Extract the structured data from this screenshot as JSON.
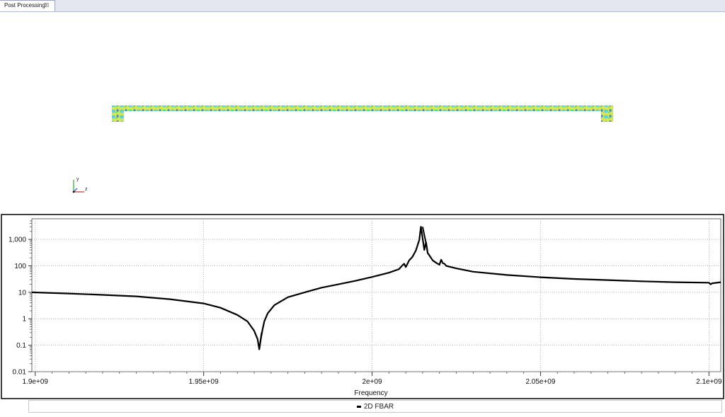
{
  "tab": {
    "title": "Post Processing:",
    "close_glyph": "☒"
  },
  "axes_triad": {
    "y_label": "y",
    "z_label": "z"
  },
  "chart_data": {
    "type": "line",
    "xlabel": "Frequency",
    "ylabel": "",
    "x_tick_labels": [
      "1.9e+09",
      "1.95e+09",
      "2e+09",
      "2.05e+09",
      "2.1e+09"
    ],
    "x_ticks": [
      1900000000,
      1950000000,
      2000000000,
      2050000000,
      2100000000
    ],
    "y_tick_labels": [
      "0.01",
      "0.1",
      "1",
      "10",
      "100",
      "1,000"
    ],
    "y_ticks": [
      0.01,
      0.1,
      1,
      10,
      100,
      1000
    ],
    "xlim": [
      1899000000,
      2103500000
    ],
    "ylim": [
      0.01,
      6000
    ],
    "y_scale": "log",
    "grid": true,
    "legend": "bottom",
    "series": [
      {
        "name": "2D FBAR",
        "color": "#000000",
        "x": [
          1899000000,
          1910000000,
          1920000000,
          1930000000,
          1940000000,
          1950000000,
          1955000000,
          1960000000,
          1963000000,
          1965000000,
          1966000000,
          1966500000,
          1967000000,
          1967500000,
          1968000000,
          1969000000,
          1971000000,
          1975000000,
          1980000000,
          1985000000,
          1990000000,
          1995000000,
          2000000000,
          2005000000,
          2008000000,
          2009000000,
          2009500000,
          2010000000,
          2011000000,
          2012000000,
          2013000000,
          2014000000,
          2014500000,
          2015000000,
          2015500000,
          2016000000,
          2016500000,
          2017000000,
          2018000000,
          2019000000,
          2020000000,
          2020500000,
          2021000000,
          2021500000,
          2022000000,
          2025000000,
          2030000000,
          2040000000,
          2050000000,
          2060000000,
          2070000000,
          2080000000,
          2090000000,
          2100000000,
          2100500000,
          2101000000,
          2103500000
        ],
        "y": [
          10,
          9,
          8,
          7,
          5.5,
          3.8,
          2.6,
          1.4,
          0.8,
          0.35,
          0.17,
          0.07,
          0.18,
          0.4,
          0.8,
          1.6,
          3.3,
          6.5,
          10,
          15,
          20,
          27,
          38,
          55,
          75,
          105,
          120,
          90,
          160,
          220,
          380,
          950,
          3000,
          1100,
          400,
          780,
          300,
          250,
          160,
          130,
          110,
          170,
          125,
          120,
          100,
          80,
          60,
          45,
          37,
          32,
          29,
          26,
          24,
          23,
          20,
          22,
          24
        ],
        "spikes": [
          {
            "x": [
              2015000000,
              2016200000
            ],
            "y": [
              3000,
              560
            ]
          },
          {
            "x": [
              1966500000,
              1967200000
            ],
            "y": [
              0.07,
              0.3
            ]
          }
        ]
      }
    ]
  }
}
